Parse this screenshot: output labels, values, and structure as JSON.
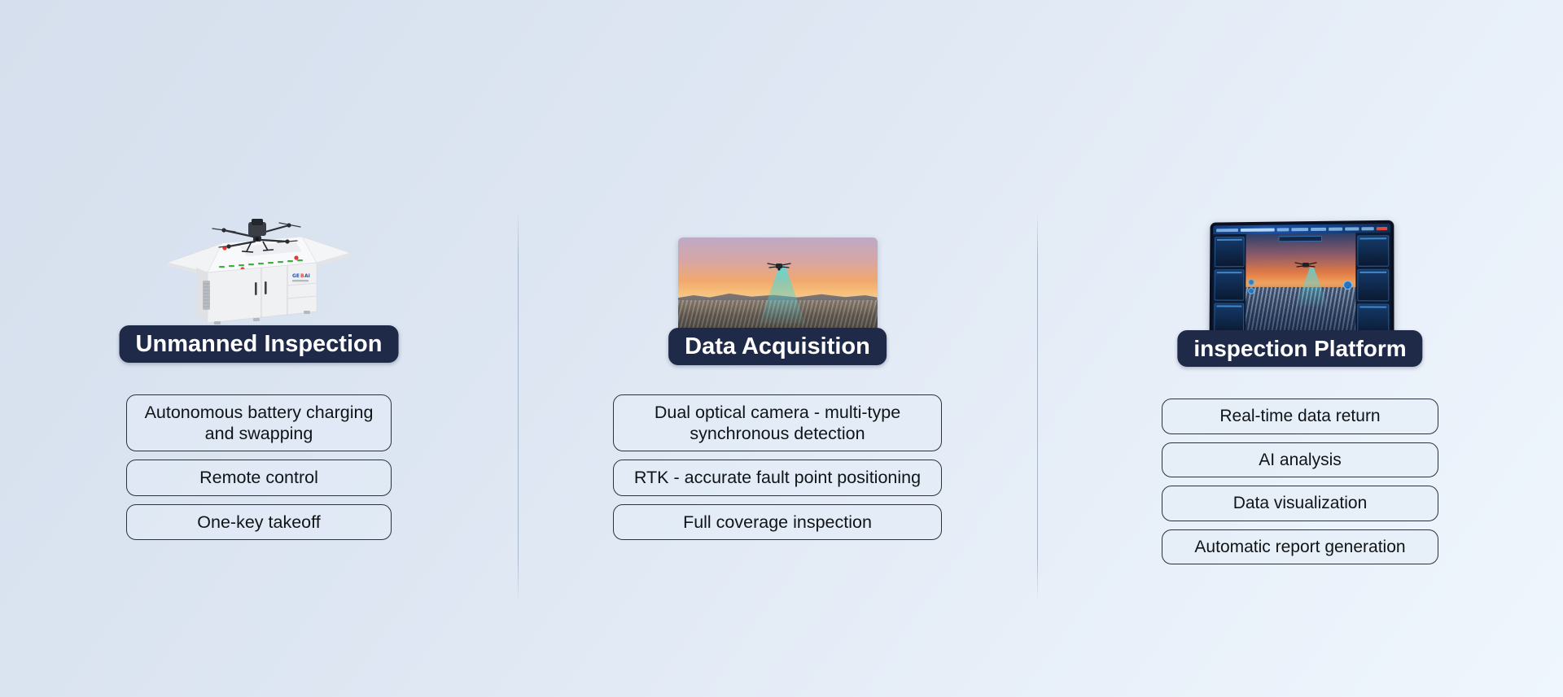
{
  "theme": {
    "background_start": "#d5dfed",
    "background_end": "#eff6fd",
    "badge_color": "#1f2a49",
    "badge_text_color": "#ffffff",
    "feature_border": "#2a3240",
    "divider_color": "#a8b6c9"
  },
  "columns": [
    {
      "id": "unmanned-inspection",
      "title": "Unmanned Inspection",
      "media": {
        "icon_name": "drone-dock-station-image",
        "alt": "Automated drone docking station with quadcopter on landing pad"
      },
      "features": [
        {
          "text": "Autonomous battery charging and swapping",
          "lines": 2
        },
        {
          "text": "Remote control",
          "lines": 1
        },
        {
          "text": "One-key takeoff",
          "lines": 1
        }
      ]
    },
    {
      "id": "data-acquisition",
      "title": "Data Acquisition",
      "media": {
        "icon_name": "drone-solar-farm-sunset-photo",
        "alt": "Drone scanning a solar panel farm at sunset with cyan sensor beam"
      },
      "features": [
        {
          "text": "Dual optical camera - multi-type synchronous detection",
          "lines": 2
        },
        {
          "text": "RTK - accurate fault point positioning",
          "lines": 1
        },
        {
          "text": "Full coverage inspection",
          "lines": 1
        }
      ]
    },
    {
      "id": "inspection-platform",
      "title": "inspection Platform",
      "media": {
        "icon_name": "tablet-dashboard-image",
        "alt": "Tablet showing drone inspection control dashboard over a solar farm"
      },
      "features": [
        {
          "text": "Real-time data return",
          "lines": 1
        },
        {
          "text": "AI analysis",
          "lines": 1
        },
        {
          "text": "Data visualization",
          "lines": 1
        },
        {
          "text": "Automatic report generation",
          "lines": 1
        }
      ]
    }
  ]
}
